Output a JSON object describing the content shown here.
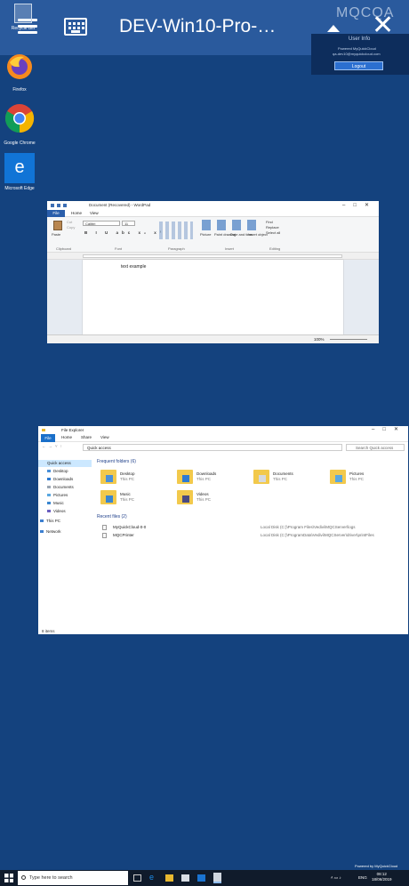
{
  "remote_bar": {
    "title": "DEV-Win10-Pro-…",
    "brand": "MQCQA",
    "brand_sub": "Powered by MyQuickCloud"
  },
  "user_info": {
    "title": "User Info",
    "line1": "Powered MyQuickCloud",
    "line2": "qa-dev10@myquickcloud.com",
    "logout_label": "Logout"
  },
  "desktop_icons": [
    {
      "label": "Recycle Bin",
      "icon": "recycle-bin-icon"
    },
    {
      "label": "Firefox",
      "icon": "firefox-icon"
    },
    {
      "label": "Google Chrome",
      "icon": "chrome-icon"
    },
    {
      "label": "Microsoft Edge",
      "icon": "edge-icon"
    }
  ],
  "wordpad": {
    "title": "Document (Recovered) - WordPad",
    "tabs": [
      "File",
      "Home",
      "View"
    ],
    "clipboard": {
      "paste": "Paste",
      "cut": "Cut",
      "copy": "Copy"
    },
    "font_name": "Calibri",
    "font_size": "11",
    "format_buttons": "B I U abc x₂ x²",
    "insert_items": [
      "Picture",
      "Paint drawing",
      "Date and time",
      "Insert object"
    ],
    "editing_items": [
      "Find",
      "Replace",
      "Select all"
    ],
    "groups": [
      "Clipboard",
      "Font",
      "Paragraph",
      "Insert",
      "Editing"
    ],
    "document_text": "text example",
    "zoom": "100%"
  },
  "explorer": {
    "title": "File Explorer",
    "tabs": [
      "File",
      "Home",
      "Share",
      "View"
    ],
    "address": "Quick access",
    "search_placeholder": "Search Quick access",
    "nav": [
      "Quick access",
      "Desktop",
      "Downloads",
      "Documents",
      "Pictures",
      "Music",
      "Videos",
      "This PC",
      "Network"
    ],
    "frequent_header": "Frequent folders (6)",
    "folders": [
      {
        "name": "Desktop",
        "sub": "This PC"
      },
      {
        "name": "Downloads",
        "sub": "This PC"
      },
      {
        "name": "Documents",
        "sub": "This PC"
      },
      {
        "name": "Pictures",
        "sub": "This PC"
      },
      {
        "name": "Music",
        "sub": "This PC"
      },
      {
        "name": "Videos",
        "sub": "This PC"
      }
    ],
    "recent_header": "Recent files (2)",
    "recent": [
      {
        "name": "MyQuickCloud-0-0",
        "path": "Local Disk (C:)\\Program Files\\Vedivi\\MQCServer\\logs"
      },
      {
        "name": "MQCPrinter",
        "path": "Local Disk (C:)\\ProgramData\\Vedivi\\MQCServer\\driver\\printFiles"
      }
    ],
    "status": "8 items"
  },
  "taskbar": {
    "search_placeholder": "Type here to search",
    "powered": "Powered by MyQuickCloud",
    "lang": "ENG",
    "time": "08:12",
    "date": "18/06/2019"
  },
  "colors": {
    "desktop": "#14427e",
    "topbar": "#2c5ca0",
    "accent": "#2b6fd0"
  }
}
